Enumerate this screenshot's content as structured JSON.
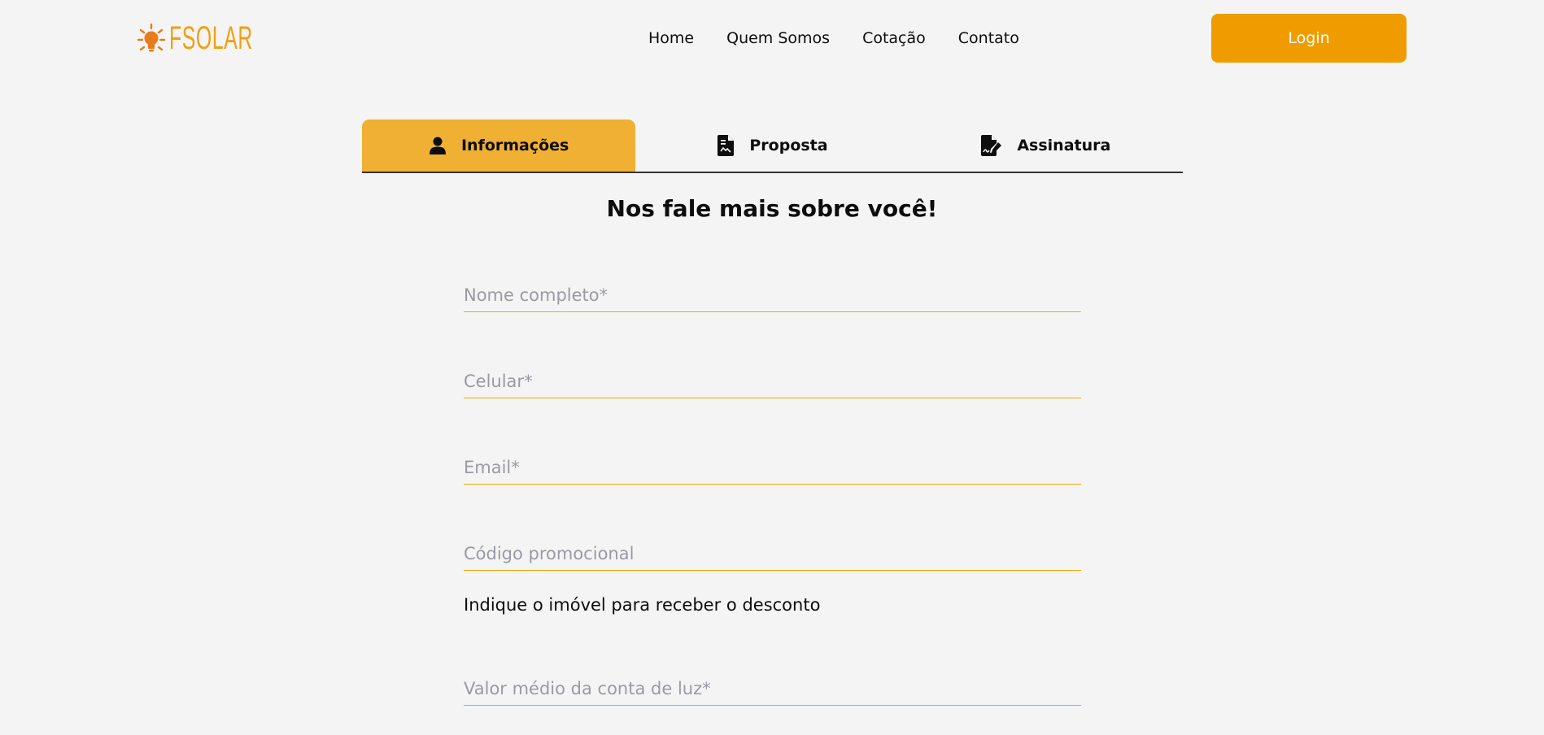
{
  "brand": {
    "logo_text": "FSOLAR",
    "accent": "#f09c00",
    "tab_active": "#f0b033"
  },
  "nav": {
    "items": [
      "Home",
      "Quem Somos",
      "Cotação",
      "Contato"
    ],
    "login_label": "Login"
  },
  "tabs": [
    {
      "label": "Informações",
      "icon": "user-icon",
      "active": true
    },
    {
      "label": "Proposta",
      "icon": "document-icon",
      "active": false
    },
    {
      "label": "Assinatura",
      "icon": "signature-icon",
      "active": false
    }
  ],
  "form": {
    "title": "Nos fale mais sobre você!",
    "fields": {
      "name": {
        "placeholder": "Nome completo*",
        "value": ""
      },
      "phone": {
        "placeholder": "Celular*",
        "value": ""
      },
      "email": {
        "placeholder": "Email*",
        "value": ""
      },
      "promo": {
        "placeholder": "Código promocional",
        "value": ""
      },
      "bill": {
        "placeholder": "Valor médio da conta de luz*",
        "value": ""
      }
    },
    "promo_hint": "Indique o imóvel para receber o desconto"
  }
}
